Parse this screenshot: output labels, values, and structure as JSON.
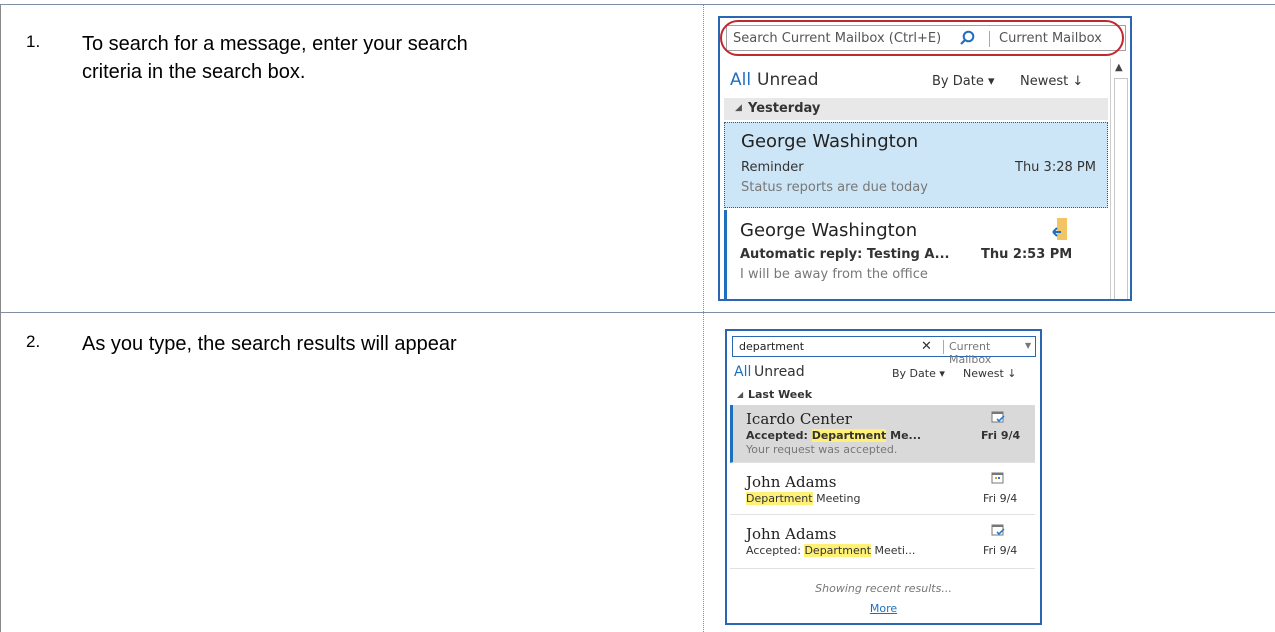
{
  "steps": [
    {
      "number": "1.",
      "text_line1": "To search for a message, enter your search",
      "text_line2": "criteria in the search box."
    },
    {
      "number": "2.",
      "text_line1": "As you type, the search results will appear"
    }
  ],
  "panel1": {
    "search_placeholder": "Search Current Mailbox (Ctrl+E)",
    "scope": "Current Mailbox",
    "filter_all": "All",
    "filter_unread": "Unread",
    "sort_by": "By Date ▾",
    "sort_order": "Newest ↓",
    "group": "Yesterday",
    "messages": [
      {
        "sender": "George Washington",
        "subject": "Reminder",
        "date": "Thu 3:28 PM",
        "preview": "Status reports are due today"
      },
      {
        "sender": "George Washington",
        "subject": "Automatic reply: Testing A...",
        "date": "Thu 2:53 PM",
        "preview": "I will be away from the office"
      }
    ]
  },
  "panel2": {
    "search_value": "department",
    "clear": "✕",
    "scope": "Current Mailbox",
    "filter_all": "All",
    "filter_unread": "Unread",
    "sort_by": "By Date ▾",
    "sort_order": "Newest ↓",
    "group": "Last Week",
    "messages": [
      {
        "sender": "Icardo Center",
        "subject_pre": "Accepted: ",
        "subject_hl": "Department",
        "subject_post": " Me...",
        "date": "Fri 9/4",
        "preview": "Your request was accepted."
      },
      {
        "sender": "John Adams",
        "subject_pre": "",
        "subject_hl": "Department",
        "subject_post": " Meeting",
        "date": "Fri 9/4"
      },
      {
        "sender": "John Adams",
        "subject_pre": "Accepted: ",
        "subject_hl": "Department",
        "subject_post": " Meeti...",
        "date": "Fri 9/4"
      }
    ],
    "showing": "Showing recent results...",
    "more": "More"
  }
}
